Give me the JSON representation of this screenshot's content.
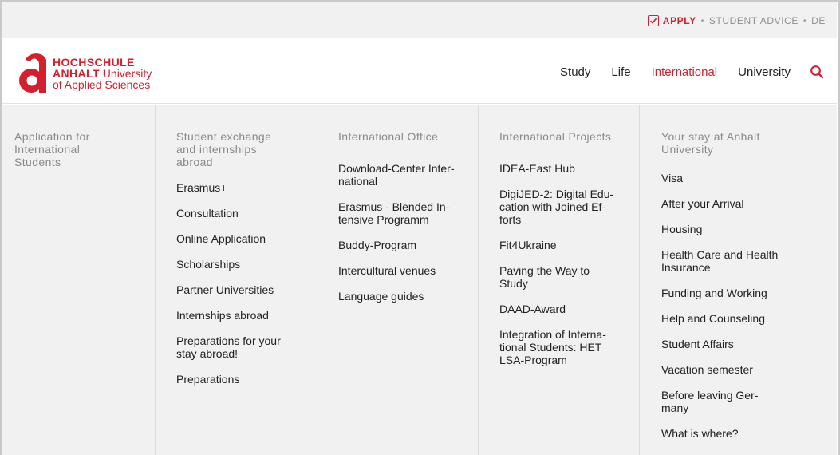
{
  "topbar": {
    "apply": "APPLY",
    "sep": "•",
    "student_advice": "STUDENT ADVICE",
    "lang": "DE"
  },
  "logo": {
    "line1": "HOCHSCHULE",
    "line2_bold": "ANHALT",
    "line2_rest": " University",
    "line3": "of Applied Sciences"
  },
  "nav": {
    "items": [
      "Study",
      "Life",
      "International",
      "University"
    ],
    "active": "International"
  },
  "menu": {
    "columns": [
      {
        "heading": "Application for\nInternational\nStudents",
        "items": []
      },
      {
        "heading": "Student exchange\nand internships\nabroad",
        "items": [
          "Erasmus+",
          "Consultation",
          "Online Application",
          "Scholarships",
          "Partner Universities",
          "Internships abroad",
          "Preparations for your\nstay abroad!",
          "Preparations"
        ]
      },
      {
        "heading": "International Office",
        "items": [
          "Download-Center Inter-\nnational",
          "Erasmus - Blended In-\ntensive Programm",
          "Buddy-Program",
          "Intercultural venues",
          "Language guides"
        ]
      },
      {
        "heading": "International Projects",
        "items": [
          "IDEA-East Hub",
          "DigiJED-2: Digital Edu-\ncation with Joined Ef-\nforts",
          "Fit4Ukraine",
          "Paving the Way to\nStudy",
          "DAAD-Award",
          "Integration of Interna-\ntional Students: HET\nLSA-Program"
        ]
      },
      {
        "heading": "Your stay at Anhalt\nUniversity",
        "items": [
          "Visa",
          "After your Arrival",
          "Housing",
          "Health Care and Health\nInsurance",
          "Funding and Working",
          "Help and Counseling",
          "Student Affairs",
          "Vacation semester",
          "Before leaving Ger-\nmany",
          "What is where?"
        ]
      }
    ]
  },
  "colors": {
    "brand_red": "#d2202f",
    "menu_bg": "#f1f1f1",
    "muted_text": "#8a8a8a"
  },
  "icons": {
    "apply": "checkbox-check-icon",
    "search": "magnifier-icon",
    "logo": "anhalt-a-mark"
  }
}
